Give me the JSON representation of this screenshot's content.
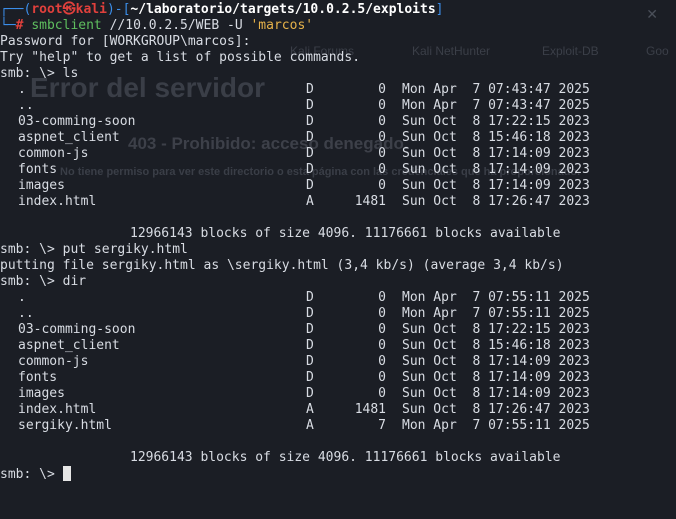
{
  "prompt": {
    "top_box": "┌──(",
    "user": "root㉿kali",
    "mid": ")-[",
    "path": "~/laboratorio/targets/10.0.2.5/exploits",
    "end": "]",
    "bottom_box": "└─",
    "hash": "#"
  },
  "command": {
    "program": "smbclient",
    "target": "//10.0.2.5/WEB",
    "flag": "-U",
    "user": "'marcos'"
  },
  "output": {
    "password_prompt": "Password for [WORKGROUP\\marcos]:",
    "help_hint": "Try \"help\" to get a list of possible commands."
  },
  "session1": {
    "prompt": "smb: \\> ",
    "command": "ls",
    "entries": [
      {
        "name": ".",
        "attr": "D",
        "size": "0",
        "date": "Mon Apr  7 07:43:47 2025"
      },
      {
        "name": "..",
        "attr": "D",
        "size": "0",
        "date": "Mon Apr  7 07:43:47 2025"
      },
      {
        "name": "03-comming-soon",
        "attr": "D",
        "size": "0",
        "date": "Sun Oct  8 17:22:15 2023"
      },
      {
        "name": "aspnet_client",
        "attr": "D",
        "size": "0",
        "date": "Sun Oct  8 15:46:18 2023"
      },
      {
        "name": "common-js",
        "attr": "D",
        "size": "0",
        "date": "Sun Oct  8 17:14:09 2023"
      },
      {
        "name": "fonts",
        "attr": "D",
        "size": "0",
        "date": "Sun Oct  8 17:14:09 2023"
      },
      {
        "name": "images",
        "attr": "D",
        "size": "0",
        "date": "Sun Oct  8 17:14:09 2023"
      },
      {
        "name": "index.html",
        "attr": "A",
        "size": "1481",
        "date": "Sun Oct  8 17:26:47 2023"
      }
    ],
    "footer": "12966143 blocks of size 4096. 11176661 blocks available"
  },
  "put": {
    "prompt": "smb: \\> ",
    "command": "put sergiky.html",
    "result": "putting file sergiky.html as \\sergiky.html (3,4 kb/s) (average 3,4 kb/s)"
  },
  "session2": {
    "prompt": "smb: \\> ",
    "command": "dir",
    "entries": [
      {
        "name": ".",
        "attr": "D",
        "size": "0",
        "date": "Mon Apr  7 07:55:11 2025"
      },
      {
        "name": "..",
        "attr": "D",
        "size": "0",
        "date": "Mon Apr  7 07:55:11 2025"
      },
      {
        "name": "03-comming-soon",
        "attr": "D",
        "size": "0",
        "date": "Sun Oct  8 17:22:15 2023"
      },
      {
        "name": "aspnet_client",
        "attr": "D",
        "size": "0",
        "date": "Sun Oct  8 15:46:18 2023"
      },
      {
        "name": "common-js",
        "attr": "D",
        "size": "0",
        "date": "Sun Oct  8 17:14:09 2023"
      },
      {
        "name": "fonts",
        "attr": "D",
        "size": "0",
        "date": "Sun Oct  8 17:14:09 2023"
      },
      {
        "name": "images",
        "attr": "D",
        "size": "0",
        "date": "Sun Oct  8 17:14:09 2023"
      },
      {
        "name": "index.html",
        "attr": "A",
        "size": "1481",
        "date": "Sun Oct  8 17:26:47 2023"
      },
      {
        "name": "sergiky.html",
        "attr": "A",
        "size": "7",
        "date": "Mon Apr  7 07:55:11 2025"
      }
    ],
    "footer": "12966143 blocks of size 4096. 11176661 blocks available"
  },
  "final_prompt": "smb: \\> ",
  "background_page": {
    "title": "Error del servidor",
    "subtitle": "403 - Prohibido: acceso denegado.",
    "description": "No tiene permiso para ver este directorio o esta página con las credenciales que ha proporcionado.",
    "description_tail": "porcionado.",
    "bookmarks": [
      "Kali Forums",
      "Kali NetHunter",
      "Exploit-DB",
      "Goo"
    ]
  },
  "colors": {
    "background": "#1b1e25",
    "text": "#d8dce3",
    "prompt_blue": "#3b8eea",
    "prompt_red": "#e0403c",
    "command_green": "#5fbf5f",
    "string_yellow": "#e6b24a"
  }
}
